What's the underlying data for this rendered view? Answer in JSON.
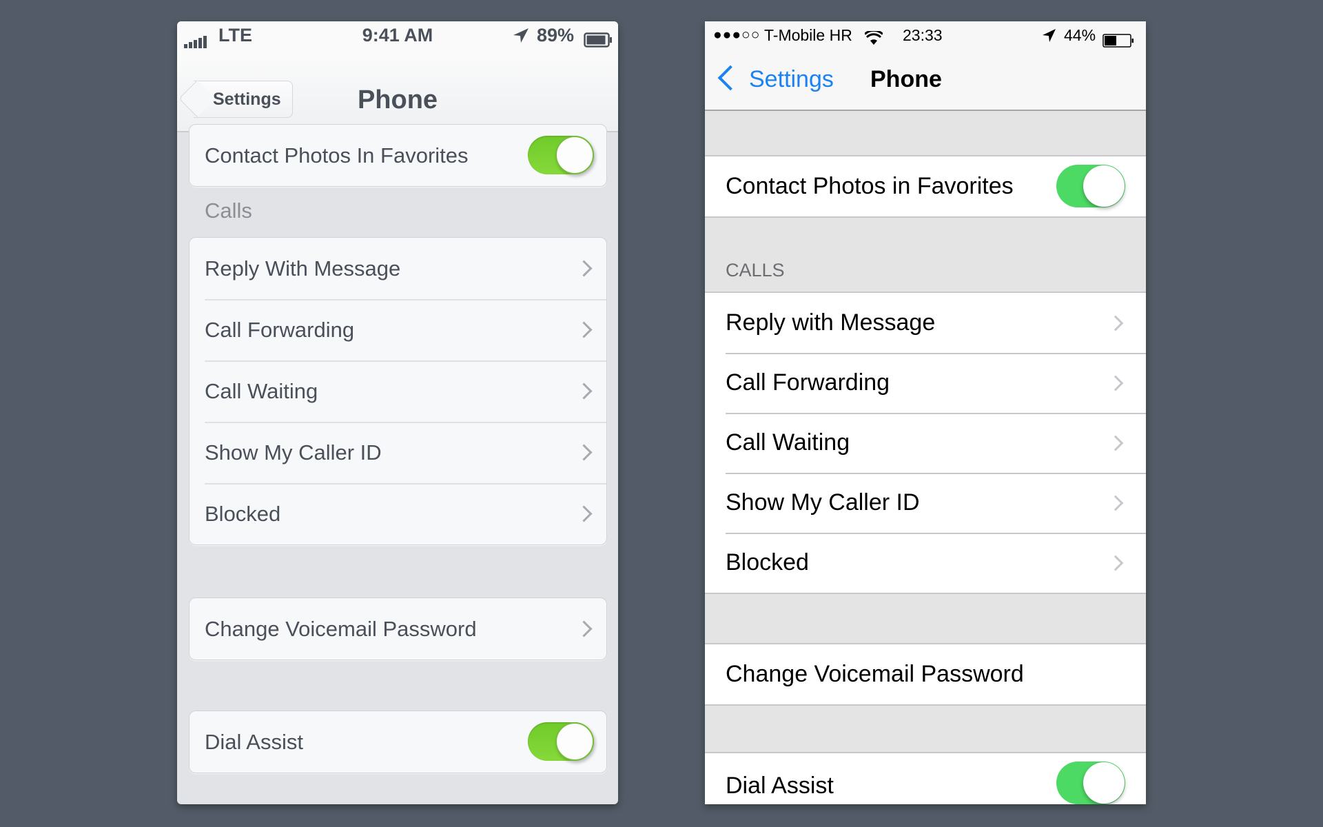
{
  "left_phone": {
    "status": {
      "carrier": "LTE",
      "signal_icon": "signal-bars-icon",
      "time": "9:41 AM",
      "location_icon": "location-arrow-icon",
      "battery": "89%",
      "battery_level": 0.89
    },
    "nav": {
      "back_label": "Settings",
      "title": "Phone"
    },
    "rows_top": [
      {
        "label": "Contact Photos In Favorites",
        "toggle": true
      }
    ],
    "calls_header": "Calls",
    "calls_rows": [
      {
        "label": "Reply With Message"
      },
      {
        "label": "Call Forwarding"
      },
      {
        "label": "Call Waiting"
      },
      {
        "label": "Show My Caller ID"
      },
      {
        "label": "Blocked"
      }
    ],
    "voicemail_row": {
      "label": "Change Voicemail Password"
    },
    "dial_assist_row": {
      "label": "Dial Assist",
      "toggle": true
    },
    "colors": {
      "toggle_on": "#7ad133",
      "text": "#4a505a"
    }
  },
  "right_phone": {
    "status": {
      "signal_dots": "●●●○○",
      "carrier": "T-Mobile HR",
      "wifi_icon": "wifi-icon",
      "time": "23:33",
      "location_icon": "location-arrow-icon",
      "battery": "44%",
      "battery_level": 0.44
    },
    "nav": {
      "back_label": "Settings",
      "title": "Phone"
    },
    "rows_top": [
      {
        "label": "Contact Photos in Favorites",
        "toggle": true
      }
    ],
    "calls_header": "CALLS",
    "calls_rows": [
      {
        "label": "Reply with Message"
      },
      {
        "label": "Call Forwarding"
      },
      {
        "label": "Call Waiting"
      },
      {
        "label": "Show My Caller ID"
      },
      {
        "label": "Blocked"
      }
    ],
    "voicemail_row": {
      "label": "Change Voicemail Password"
    },
    "dial_assist_row": {
      "label": "Dial Assist",
      "toggle": true
    },
    "colors": {
      "toggle_on": "#4cd964",
      "accent": "#1a82f1"
    }
  }
}
